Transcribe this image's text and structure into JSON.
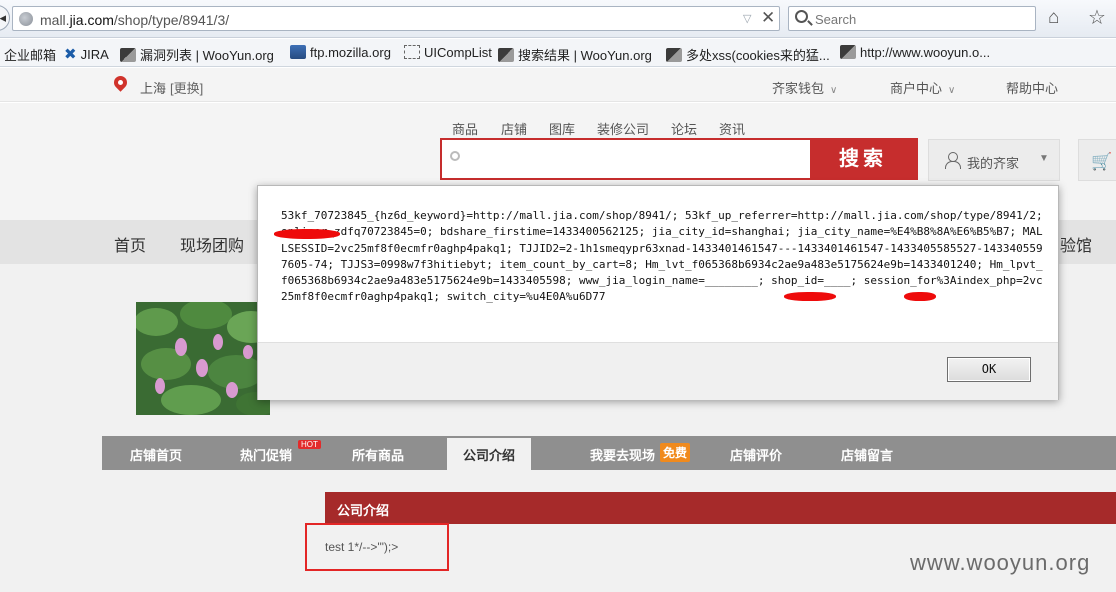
{
  "browser": {
    "back_glyph": "◂",
    "url_prefix": "mall.",
    "url_host": "jia.com",
    "url_path": "/shop/type/8941/3/",
    "url_dropdown_glyph": "▽",
    "url_close_glyph": "✕",
    "search_placeholder": "Search",
    "home_glyph": "⌂",
    "star_glyph": "☆",
    "bookmarks": [
      "企业邮箱",
      "JIRA",
      "漏洞列表 | WooYun.org",
      "ftp.mozilla.org",
      "UICompList",
      "搜索结果 | WooYun.org",
      "多处xss(cookies来的猛...",
      "http://www.wooyun.o..."
    ]
  },
  "site": {
    "city": "上海",
    "city_switch": "[更换]",
    "top_links": [
      "齐家钱包",
      "商户中心",
      "帮助中心"
    ],
    "caret": "∨",
    "search_tabs": [
      "商品",
      "店铺",
      "图库",
      "装修公司",
      "论坛",
      "资讯"
    ],
    "search_button": "搜索",
    "my_account": "我的齐家",
    "account_caret": "▼",
    "cart_glyph": "🛒",
    "nav": [
      "首页",
      "现场团购",
      "验馆"
    ],
    "shop_tabs": [
      "店铺首页",
      "热门促销",
      "所有商品",
      "公司介绍",
      "我要去现场",
      "店铺评价",
      "店铺留言"
    ],
    "tag_hot": "HOT",
    "tag_free": "免费",
    "section_title": "公司介绍",
    "content_text": "test 1*/-->'\");>",
    "watermark": "www.wooyun.org"
  },
  "dialog": {
    "message": "53kf_70723845_{hz6d_keyword}=http://mall.jia.com/shop/8941/; 53kf_up_referrer=http://mall.jia.com/shop/type/8941/2; onliner_zdfq70723845=0; bdshare_firstime=1433400562125; jia_city_id=shanghai; jia_city_name=%E4%B8%8A%E6%B5%B7; MALLSESSID=2vc25mf8f0ecmfr0aghp4pakq1; TJJID2=2-1h1smeqypr63xnad-1433401461547---1433401461547-1433405585527-1433405597605-74; TJJS3=0998w7f3hitiebyt; item_count_by_cart=8; Hm_lvt_f065368b6934c2ae9a483e5175624e9b=1433401240; Hm_lpvt_f065368b6934c2ae9a483e5175624e9b=1433405598; www_jia_login_name=________; shop_id=____; session_for%3Aindex_php=2vc25mf8f0ecmfr0aghp4pakq1; switch_city=%u4E0A%u6D77",
    "ok_label": "OK"
  },
  "colors": {
    "brand_red": "#c62d2d",
    "redaction": "#ee0b0b"
  }
}
